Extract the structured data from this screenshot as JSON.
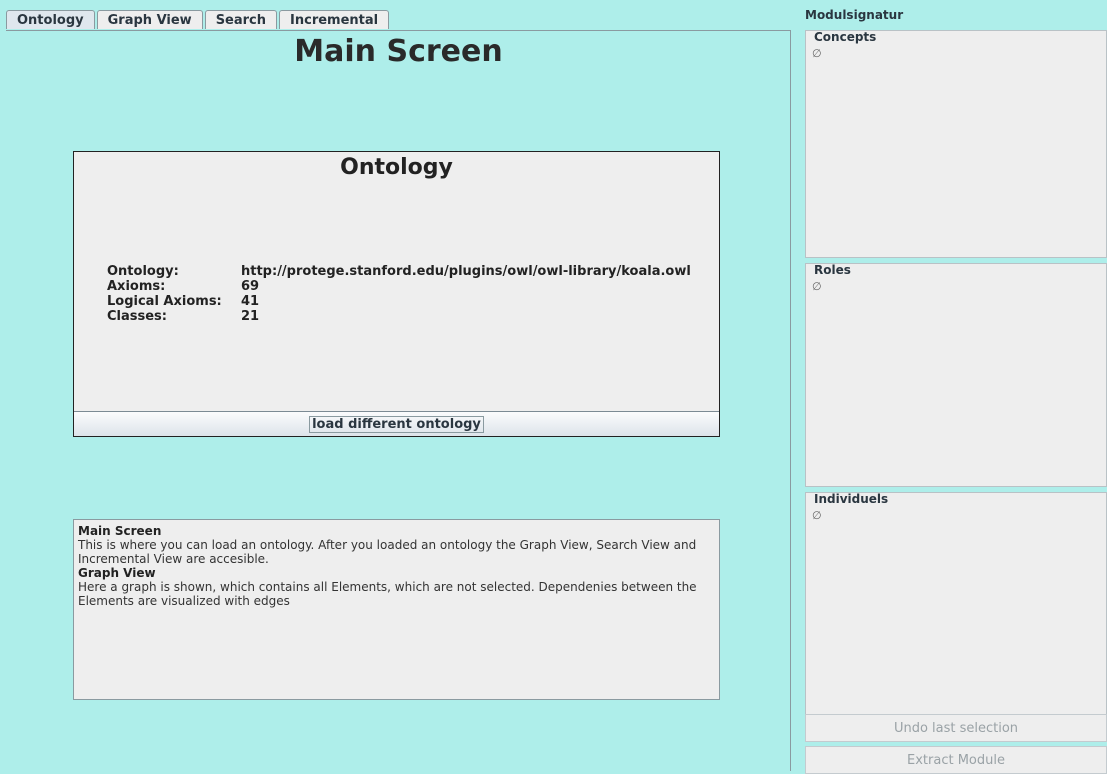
{
  "tabs": [
    {
      "label": "Ontology"
    },
    {
      "label": "Graph View"
    },
    {
      "label": "Search"
    },
    {
      "label": "Incremental"
    }
  ],
  "main": {
    "title": "Main Screen",
    "ontology_panel": {
      "title": "Ontology",
      "rows": [
        {
          "key": "Ontology:",
          "value": "http://protege.stanford.edu/plugins/owl/owl-library/koala.owl"
        },
        {
          "key": "Axioms:",
          "value": "69"
        },
        {
          "key": "Logical Axioms:",
          "value": "41"
        },
        {
          "key": "Classes:",
          "value": "21"
        }
      ],
      "load_button": "load different ontology"
    },
    "help": {
      "heading1": "Main Screen",
      "text1": "This is where you can load an ontology. After you loaded an ontology the Graph View, Search View and Incremental View are accesible.",
      "heading2": "Graph View",
      "text2": "Here a graph is shown, which contains all Elements, which are not selected. Dependenies between the Elements are visualized with edges"
    }
  },
  "sidebar": {
    "title": "Modulsignatur",
    "sections": [
      {
        "label": "Concepts",
        "content": "∅"
      },
      {
        "label": "Roles",
        "content": "∅"
      },
      {
        "label": "Individuels",
        "content": "∅"
      }
    ],
    "undo_button": "Undo last selection",
    "extract_button": "Extract Module"
  },
  "colors": {
    "background": "#aeeeea",
    "panel": "#eeeeee"
  }
}
